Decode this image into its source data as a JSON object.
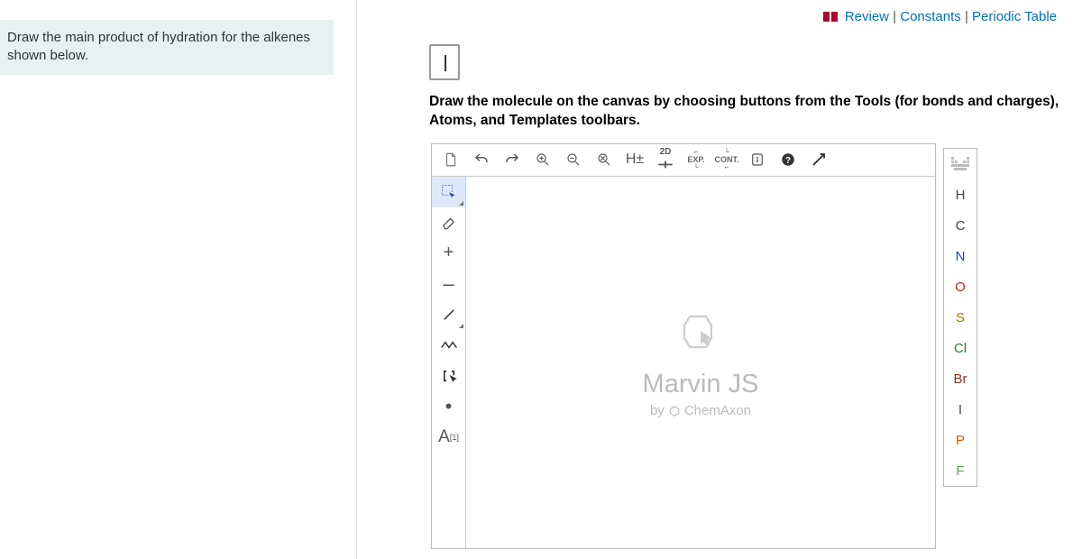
{
  "prompt": "Draw the main product of hydration for the alkenes shown below.",
  "topLinks": {
    "review": "Review",
    "constants": "Constants",
    "periodic": "Periodic Table"
  },
  "instruction_bold": "Draw the molecule on the canvas by choosing buttons from the Tools (for bonds and charges), Atoms, and Templates toolbars.",
  "toolbar": {
    "hpm": "H±",
    "twod": "2D",
    "exp": "EXP.",
    "cont": "CONT."
  },
  "leftTools": {
    "plus": "+",
    "minus": "–",
    "atomlabel": "A",
    "atomlabel_sup": "[1]",
    "dot": "•"
  },
  "brand": {
    "name": "Marvin JS",
    "by": "by",
    "company": "ChemAxon"
  },
  "atoms": {
    "H": "H",
    "C": "C",
    "N": "N",
    "O": "O",
    "S": "S",
    "Cl": "Cl",
    "Br": "Br",
    "I": "I",
    "P": "P",
    "F": "F"
  },
  "colors": {
    "H": "#444",
    "C": "#444",
    "N": "#2040dd",
    "O": "#d02020",
    "S": "#a08000",
    "Cl": "#1a8a1a",
    "Br": "#8b3020",
    "I": "#444",
    "P": "#c06000",
    "F": "#6aa060"
  }
}
